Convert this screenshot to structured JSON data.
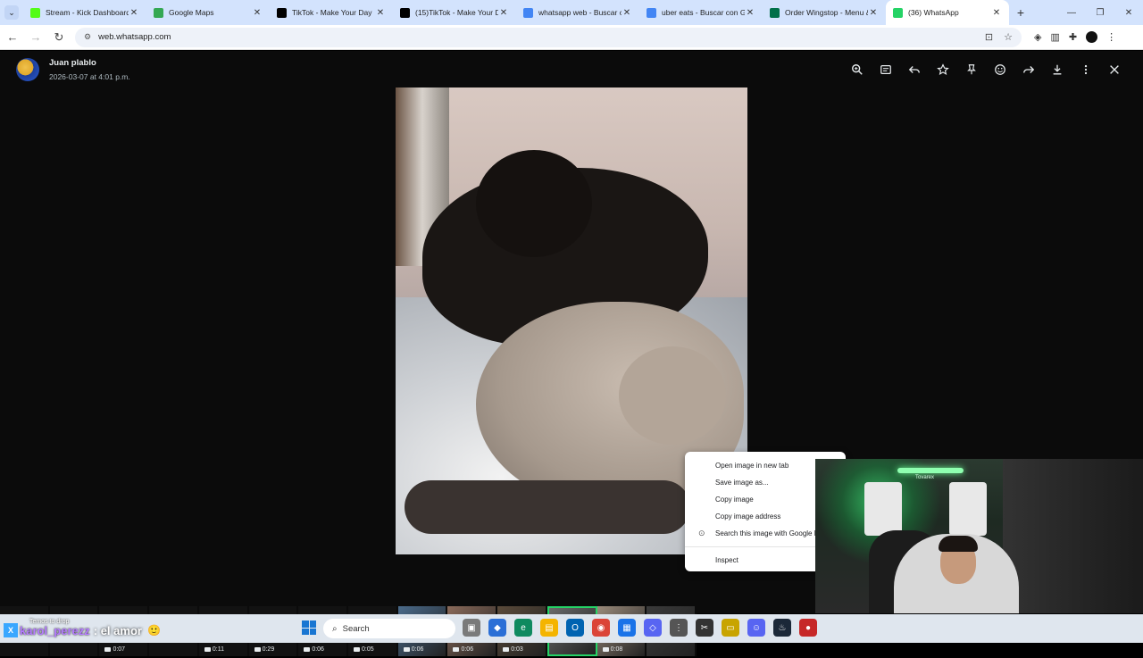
{
  "browser": {
    "tabs": [
      {
        "title": "Stream - Kick Dashboard",
        "color": "#53fc18"
      },
      {
        "title": "Google Maps",
        "color": "#34a853"
      },
      {
        "title": "TikTok - Make Your Day",
        "color": "#000000"
      },
      {
        "title": "(15)TikTok - Make Your Da",
        "color": "#000000"
      },
      {
        "title": "whatsapp web - Buscar co",
        "color": "#4285f4"
      },
      {
        "title": "uber eats - Buscar con Go",
        "color": "#4285f4"
      },
      {
        "title": "Order Wingstop - Menu &",
        "color": "#00704a"
      },
      {
        "title": "(36) WhatsApp",
        "color": "#25d366"
      }
    ],
    "url": "web.whatsapp.com"
  },
  "viewer": {
    "sender_name": "Juan plablo",
    "sender_date": "2026-03-07 at 4:01 p.m.",
    "toolbar_icons": [
      "zoom-in-icon",
      "caption-icon",
      "reply-icon",
      "star-icon",
      "pin-icon",
      "emoji-icon",
      "forward-icon",
      "download-icon",
      "more-icon",
      "close-icon"
    ],
    "thumbnails": [
      {
        "kind": "download",
        "duration": ""
      },
      {
        "kind": "download",
        "duration": ""
      },
      {
        "kind": "download",
        "duration": "0:07"
      },
      {
        "kind": "download",
        "duration": ""
      },
      {
        "kind": "download",
        "duration": "0:11"
      },
      {
        "kind": "download",
        "duration": "0:29"
      },
      {
        "kind": "download",
        "duration": "0:06"
      },
      {
        "kind": "download",
        "duration": "0:05"
      },
      {
        "kind": "image",
        "duration": "0:06",
        "color": "#4a6a8a"
      },
      {
        "kind": "image",
        "duration": "0:06",
        "color": "#8a6a5a"
      },
      {
        "kind": "image",
        "duration": "0:03",
        "color": "#5a4a3a"
      },
      {
        "kind": "image",
        "duration": "",
        "color": "#6a6a6a",
        "selected": true
      },
      {
        "kind": "image",
        "duration": "0:08",
        "color": "#9a8a7a"
      },
      {
        "kind": "image",
        "duration": "",
        "color": "#3a3a3a"
      }
    ]
  },
  "context_menu": {
    "items": [
      "Open image in new tab",
      "Save image as...",
      "Copy image",
      "Copy image address",
      "Search this image with Google Lens",
      "Inspect"
    ]
  },
  "stream": {
    "chat_hint": "Temos to drop",
    "chat_user": "karol_perezz",
    "chat_message": ": el amor",
    "led_label": "Tovarex"
  },
  "taskbar": {
    "search_placeholder": "Search"
  }
}
